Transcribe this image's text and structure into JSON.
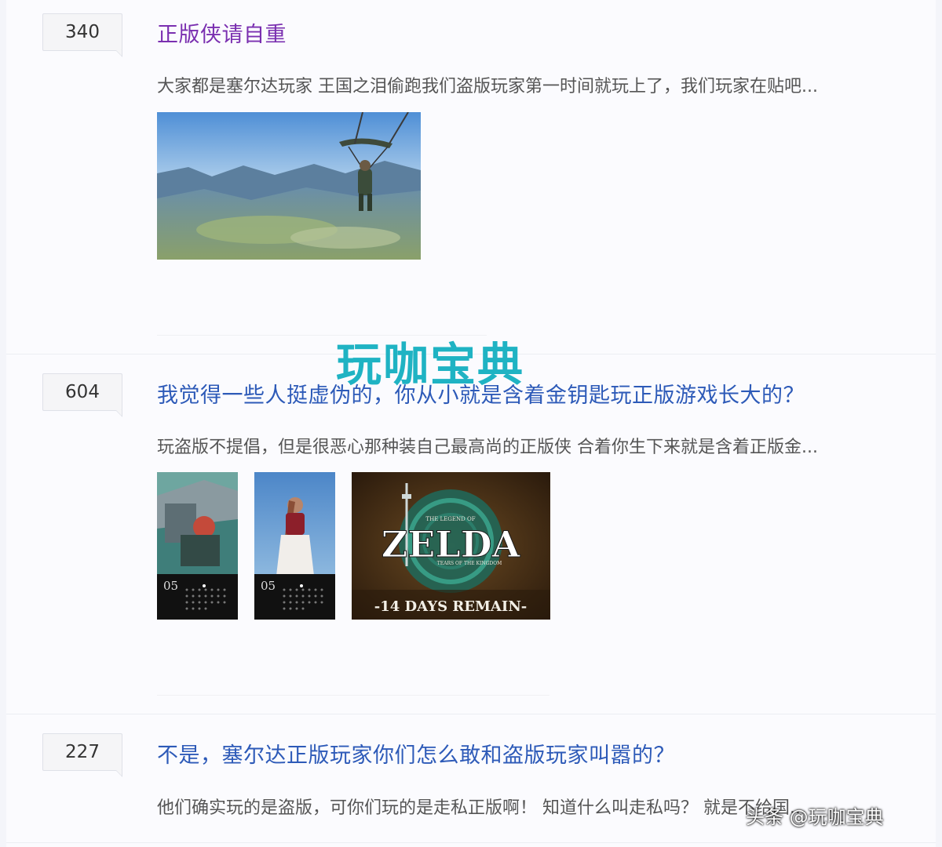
{
  "posts": [
    {
      "reply_count": "340",
      "title": "正版侠请自重",
      "abstract": "大家都是塞尔达玩家 王国之泪偷跑我们盗版玩家第一时间就玩上了，我们玩家在贴吧..."
    },
    {
      "reply_count": "604",
      "title": "我觉得一些人挺虚伪的，你从小就是含着金钥匙玩正版游戏长大的？",
      "abstract": "玩盗版不提倡，但是很恶心那种装自己最高尚的正版侠 合着你生下来就是含着正版金...",
      "images": {
        "calendar_day_1": "05",
        "calendar_day_2": "05",
        "zelda_logo": "ZELDA",
        "zelda_top": "THE LEGEND OF",
        "zelda_sub": "TEARS OF THE KINGDOM",
        "zelda_banner": "-14 DAYS REMAIN-"
      }
    },
    {
      "reply_count": "227",
      "title": "不是，塞尔达正版玩家你们怎么敢和盗版玩家叫嚣的？",
      "abstract": "他们确实玩的是盗版，可你们玩的是走私正版啊！ 知道什么叫走私吗？ 就是不给国..."
    }
  ],
  "watermark": "玩咖宝典",
  "credit": "头条 @玩咖宝典",
  "colors": {
    "visited_title": "#7a2fb0",
    "link_title": "#2d5ab8",
    "watermark": "#1fb3c3"
  }
}
